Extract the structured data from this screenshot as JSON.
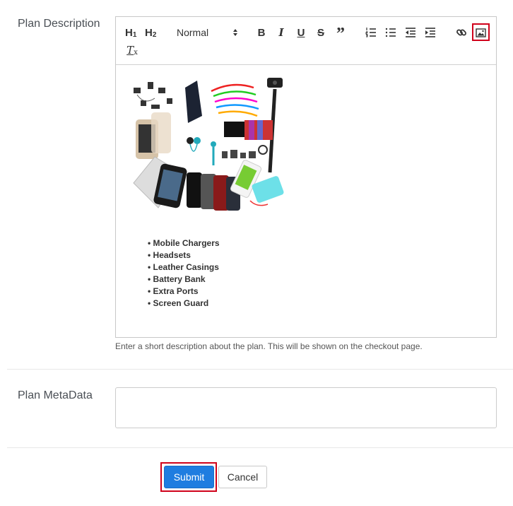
{
  "plan_description": {
    "label": "Plan Description",
    "help_text": "Enter a short description about the plan. This will be shown on the checkout page."
  },
  "toolbar": {
    "h1": "H",
    "h1_sub": "1",
    "h2": "H",
    "h2_sub": "2",
    "format_select_value": "Normal",
    "bold": "B",
    "italic": "I",
    "underline": "U",
    "strike": "S",
    "quote": "”",
    "clear": "T",
    "clear_sub": "x"
  },
  "editor": {
    "image_alt": "Mobile accessories product image",
    "bullets": [
      "Mobile Chargers",
      "Headsets",
      "Leather Casings",
      "Battery Bank",
      "Extra Ports",
      "Screen Guard"
    ]
  },
  "plan_metadata": {
    "label": "Plan MetaData",
    "value": ""
  },
  "actions": {
    "submit_label": "Submit",
    "cancel_label": "Cancel"
  },
  "colors": {
    "accent": "#1f7de0",
    "highlight": "#d0021b"
  }
}
